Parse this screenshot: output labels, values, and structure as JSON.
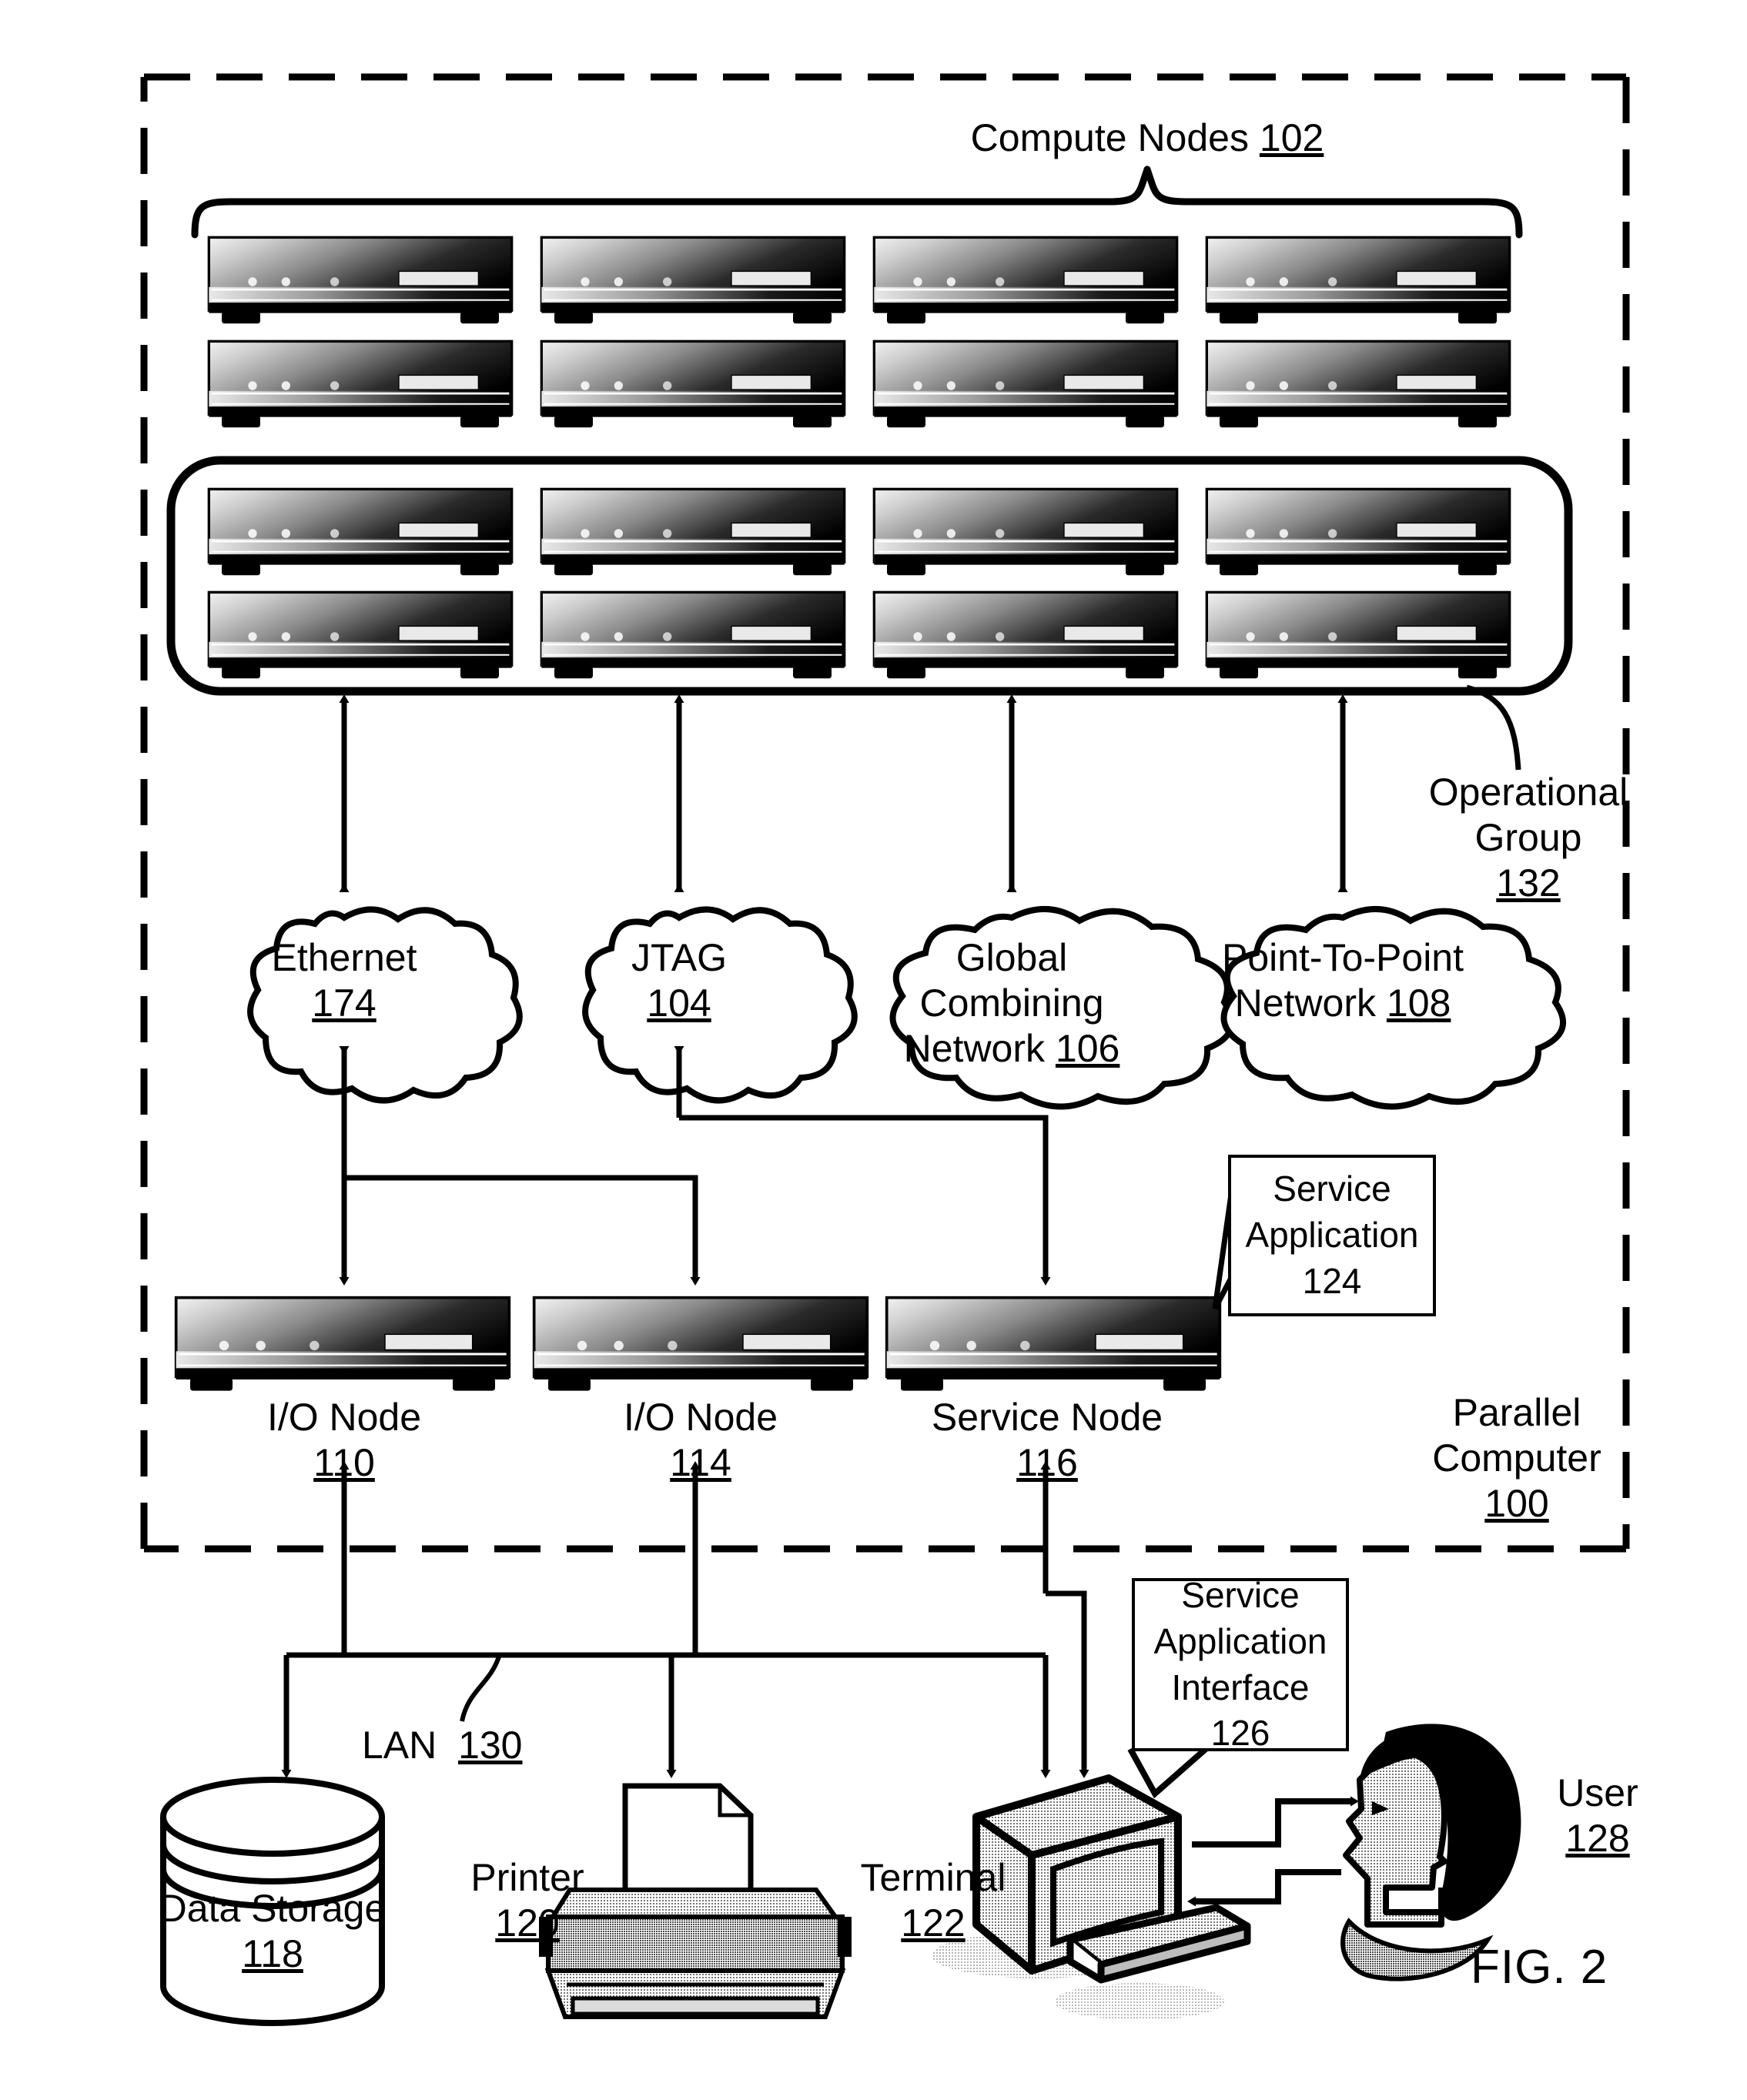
{
  "figure": {
    "caption": "FIG. 2",
    "outer_boundary_label": {
      "line1": "Parallel",
      "line2": "Computer",
      "ref": "100"
    }
  },
  "compute": {
    "title": "Compute Nodes",
    "title_ref": "102",
    "rows_free": 2,
    "cols": 4,
    "rows_group": 2,
    "node_icon": "server-node-icon"
  },
  "operational_group": {
    "line1": "Operational",
    "line2": "Group",
    "ref": "132"
  },
  "networks": [
    {
      "name": "ethernet",
      "line1": "Ethernet",
      "line2": "",
      "ref": "174"
    },
    {
      "name": "jtag",
      "line1": "JTAG",
      "line2": "",
      "ref": "104"
    },
    {
      "name": "global-combining",
      "line1": "Global Combining",
      "line2": "Network",
      "ref": "106"
    },
    {
      "name": "point-to-point",
      "line1": "Point-To-Point",
      "line2": "Network",
      "ref": "108"
    }
  ],
  "nodes": [
    {
      "name": "io-node-110",
      "label": "I/O Node",
      "ref": "110"
    },
    {
      "name": "io-node-114",
      "label": "I/O Node",
      "ref": "114"
    },
    {
      "name": "service-node",
      "label": "Service Node",
      "ref": "116"
    }
  ],
  "service_application": {
    "line1": "Service",
    "line2": "Application",
    "ref": "124"
  },
  "service_application_interface": {
    "line1": "Service",
    "line2": "Application",
    "line3": "Interface",
    "ref": "126"
  },
  "lan": {
    "label": "LAN",
    "ref": "130"
  },
  "peripherals": [
    {
      "name": "data-storage",
      "label": "Data Storage",
      "ref": "118",
      "icon": "cylinder-database-icon"
    },
    {
      "name": "printer",
      "label": "Printer",
      "ref": "120",
      "icon": "printer-icon"
    },
    {
      "name": "terminal",
      "label": "Terminal",
      "ref": "122",
      "icon": "crt-monitor-icon"
    }
  ],
  "user": {
    "label": "User",
    "ref": "128",
    "icon": "person-head-icon"
  },
  "colors": {
    "ink": "#000000",
    "paper": "#ffffff"
  }
}
